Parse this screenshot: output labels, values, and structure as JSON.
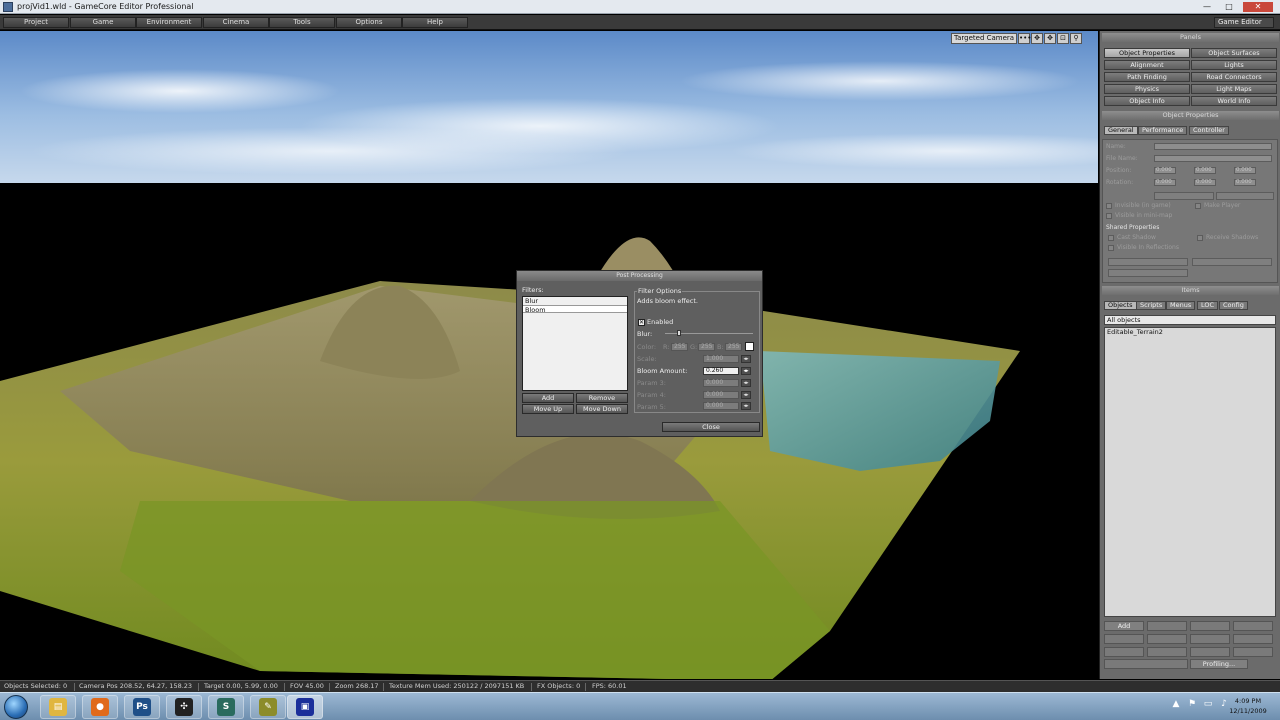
{
  "window": {
    "title": "projVid1.wld - GameCore Editor Professional",
    "controls": {
      "minimize": "—",
      "maximize": "□",
      "close": "✕"
    }
  },
  "menu": {
    "items": [
      "Project",
      "Game",
      "Environment",
      "Cinema",
      "Tools",
      "Options",
      "Help"
    ],
    "mode": "Game Editor"
  },
  "viewport": {
    "camera_select": "Targeted Camera",
    "tools": [
      "•••",
      "✥",
      "✥",
      "⊡",
      "⚲"
    ]
  },
  "post_processing": {
    "title": "Post Processing",
    "filters_label": "Filters:",
    "filters": [
      "Blur",
      "Bloom"
    ],
    "selected_filter": "Bloom",
    "buttons": {
      "add": "Add",
      "remove": "Remove",
      "move_up": "Move Up",
      "move_down": "Move Down",
      "close": "Close"
    },
    "options": {
      "group_label": "Filter Options",
      "description": "Adds bloom effect.",
      "enabled_label": "Enabled",
      "enabled_mark": "✕",
      "blur_label": "Blur:",
      "color_label": "Color:",
      "color_r_label": "R:",
      "color_r": "255",
      "color_g_label": "G:",
      "color_g": "255",
      "color_b_label": "B:",
      "color_b": "255",
      "scale_label": "Scale:",
      "scale_value": "1.000",
      "bloom_label": "Bloom Amount:",
      "bloom_value": "0.260",
      "param3_label": "Param 3:",
      "param3_value": "0.000",
      "param4_label": "Param 4:",
      "param4_value": "0.000",
      "param5_label": "Param 5:",
      "param5_value": "0.000",
      "spin_glyph": "◂▸"
    }
  },
  "panels": {
    "header": "Panels",
    "buttons": [
      "Object Properties",
      "Object Surfaces",
      "Alignment",
      "Lights",
      "Path Finding",
      "Road Connectors",
      "Physics",
      "Light Maps",
      "Object Info",
      "World Info"
    ],
    "active": "Object Properties"
  },
  "object_properties": {
    "header": "Object Properties",
    "tabs": [
      "General",
      "Performance",
      "Controller"
    ],
    "active_tab": "General",
    "name_label": "Name:",
    "filename_label": "File Name:",
    "position_label": "Position:",
    "rotation_label": "Rotation:",
    "zero": "0.000",
    "invisible_game": "Invisible (in game)",
    "invisible_minimap": "Visible in mini-map",
    "make_player": "Make Player",
    "shared_header": "Shared Properties",
    "cast_shadow": "Cast Shadow",
    "receive_shadows": "Receive Shadows",
    "visible_reflections": "Visible In Reflections"
  },
  "items": {
    "header": "Items",
    "tabs": [
      "Objects",
      "Scripts",
      "Menus",
      "LOC",
      "Config"
    ],
    "active_tab": "Objects",
    "filter": "All objects",
    "rows": [
      "Editable_Terrain2"
    ],
    "add_button": "Add",
    "profiling_button": "Profiling..."
  },
  "status": {
    "objects_selected": "Objects Selected: 0",
    "camera_pos": "Camera Pos 208.52, 64.27, 158.23",
    "target": "Target 0.00, 5.99, 0.00",
    "fov": "FOV 45.00",
    "zoom": "Zoom 268.17",
    "texture_mem": "Texture Mem Used: 250122 / 2097151 KB",
    "fx_objects": "FX Objects: 0",
    "fps": "FPS: 60.01"
  },
  "taskbar": {
    "apps": [
      {
        "name": "explorer",
        "glyph": "▤",
        "color": "#e0b640"
      },
      {
        "name": "firefox",
        "glyph": "●",
        "color": "#e06a1b"
      },
      {
        "name": "photoshop",
        "glyph": "Ps",
        "color": "#1f4f88"
      },
      {
        "name": "unity",
        "glyph": "✣",
        "color": "#222222"
      },
      {
        "name": "gamecore-s",
        "glyph": "S",
        "color": "#2a6b5e"
      },
      {
        "name": "paint-tool",
        "glyph": "✎",
        "color": "#8c8c2a"
      },
      {
        "name": "gamecore-editor",
        "glyph": "▣",
        "color": "#1b2f9a"
      }
    ],
    "tray": [
      "▲",
      "⚑",
      "▭",
      "♪"
    ],
    "time": "4:09 PM",
    "date": "12/11/2009"
  }
}
